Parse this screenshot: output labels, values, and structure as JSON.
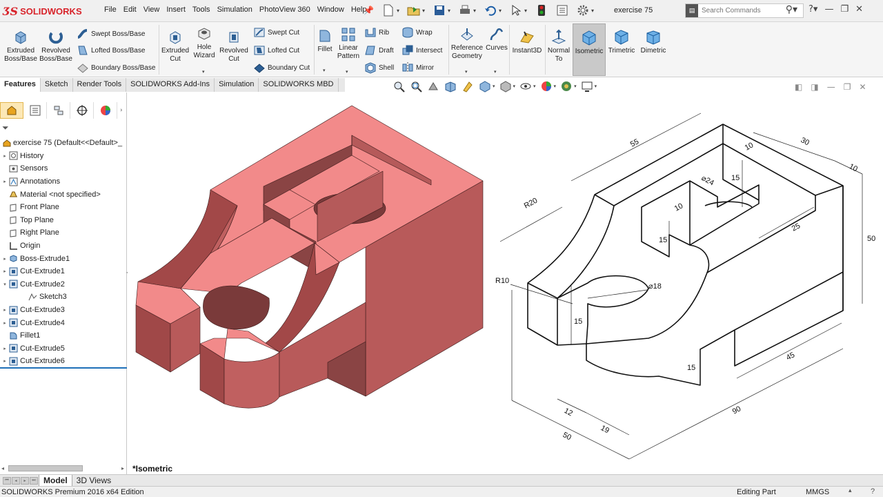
{
  "app": {
    "brand": "SOLIDWORKS",
    "document_title": "exercise 75"
  },
  "menu": [
    "File",
    "Edit",
    "View",
    "Insert",
    "Tools",
    "Simulation",
    "PhotoView 360",
    "Window",
    "Help"
  ],
  "search": {
    "placeholder": "Search Commands"
  },
  "ribbon": {
    "extruded_boss": "Extruded\nBoss/Base",
    "revolved_boss": "Revolved\nBoss/Base",
    "swept_boss": "Swept Boss/Base",
    "lofted_boss": "Lofted Boss/Base",
    "boundary_boss": "Boundary Boss/Base",
    "extruded_cut": "Extruded\nCut",
    "hole_wizard": "Hole\nWizard",
    "revolved_cut": "Revolved\nCut",
    "swept_cut": "Swept Cut",
    "lofted_cut": "Lofted Cut",
    "boundary_cut": "Boundary Cut",
    "fillet": "Fillet",
    "linear_pattern": "Linear\nPattern",
    "rib": "Rib",
    "draft": "Draft",
    "shell": "Shell",
    "wrap": "Wrap",
    "intersect": "Intersect",
    "mirror": "Mirror",
    "reference_geometry": "Reference\nGeometry",
    "curves": "Curves",
    "instant3d": "Instant3D",
    "normal_to": "Normal\nTo",
    "isometric": "Isometric",
    "trimetric": "Trimetric",
    "dimetric": "Dimetric"
  },
  "tabs": [
    "Features",
    "Sketch",
    "Render Tools",
    "SOLIDWORKS Add-Ins",
    "Simulation",
    "SOLIDWORKS MBD"
  ],
  "tree": {
    "root": "exercise 75  (Default<<Default>_",
    "items": [
      {
        "label": "History",
        "expand": true,
        "icon": "history-icon"
      },
      {
        "label": "Sensors",
        "expand": false,
        "icon": "sensors-icon"
      },
      {
        "label": "Annotations",
        "expand": true,
        "icon": "annotations-icon"
      },
      {
        "label": "Material <not specified>",
        "expand": false,
        "icon": "material-icon"
      },
      {
        "label": "Front Plane",
        "expand": false,
        "icon": "plane-icon"
      },
      {
        "label": "Top Plane",
        "expand": false,
        "icon": "plane-icon"
      },
      {
        "label": "Right Plane",
        "expand": false,
        "icon": "plane-icon"
      },
      {
        "label": "Origin",
        "expand": false,
        "icon": "origin-icon"
      },
      {
        "label": "Boss-Extrude1",
        "expand": true,
        "icon": "boss-extrude-icon"
      },
      {
        "label": "Cut-Extrude1",
        "expand": true,
        "icon": "cut-extrude-icon"
      },
      {
        "label": "Cut-Extrude2",
        "expand": true,
        "open": true,
        "icon": "cut-extrude-icon"
      },
      {
        "label": "Sketch3",
        "expand": false,
        "indent": true,
        "icon": "sketch-icon"
      },
      {
        "label": "Cut-Extrude3",
        "expand": true,
        "icon": "cut-extrude-icon"
      },
      {
        "label": "Cut-Extrude4",
        "expand": true,
        "icon": "cut-extrude-icon"
      },
      {
        "label": "Fillet1",
        "expand": false,
        "icon": "fillet-icon"
      },
      {
        "label": "Cut-Extrude5",
        "expand": true,
        "icon": "cut-extrude-icon"
      },
      {
        "label": "Cut-Extrude6",
        "expand": true,
        "icon": "cut-extrude-icon"
      }
    ]
  },
  "viewport": {
    "view_label": "*Isometric",
    "model_color": "#f08080",
    "dimensions": [
      "55",
      "30",
      "10",
      "10",
      "15",
      "⌀24",
      "R20",
      "10",
      "15",
      "25",
      "50",
      "R10",
      "⌀18",
      "15",
      "15",
      "45",
      "12",
      "19",
      "90",
      "50"
    ]
  },
  "bottom_tabs": [
    "Model",
    "3D Views"
  ],
  "status": {
    "edition": "SOLIDWORKS Premium 2016 x64 Edition",
    "mode": "Editing Part",
    "units": "MMGS"
  }
}
